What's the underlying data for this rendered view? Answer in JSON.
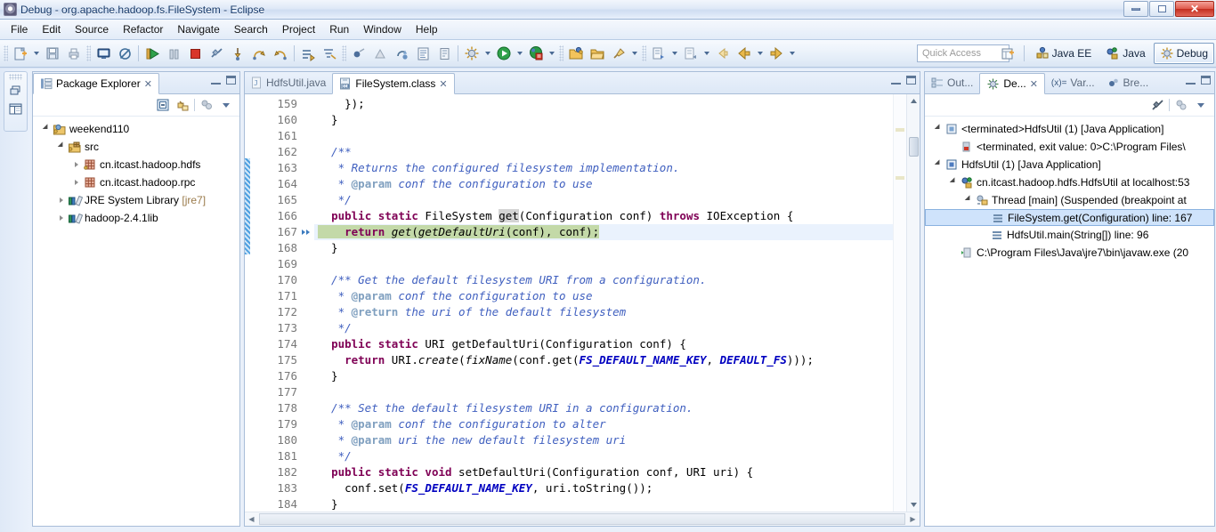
{
  "window": {
    "title": "Debug - org.apache.hadoop.fs.FileSystem - Eclipse",
    "app_icon": "eclipse-icon",
    "controls": {
      "minimize": "minimize-icon",
      "restore": "restore-icon",
      "close": "✕"
    }
  },
  "menubar": {
    "items": [
      {
        "label": "File"
      },
      {
        "label": "Edit"
      },
      {
        "label": "Source"
      },
      {
        "label": "Refactor"
      },
      {
        "label": "Navigate"
      },
      {
        "label": "Search"
      },
      {
        "label": "Project"
      },
      {
        "label": "Run"
      },
      {
        "label": "Window"
      },
      {
        "label": "Help"
      }
    ]
  },
  "toolbar": {
    "buttons": [
      {
        "name": "new-wizard-icon",
        "has_dropdown": true
      },
      {
        "name": "save-icon",
        "has_dropdown": false
      },
      {
        "name": "print-icon",
        "has_dropdown": false
      },
      {
        "name": "console-icon",
        "has_dropdown": false
      },
      {
        "name": "skip-breakpoints-icon",
        "has_dropdown": false
      },
      {
        "name": "resume-icon",
        "has_dropdown": false
      },
      {
        "name": "suspend-icon",
        "has_dropdown": false
      },
      {
        "name": "terminate-icon",
        "has_dropdown": false
      },
      {
        "name": "disconnect-icon",
        "has_dropdown": false
      },
      {
        "name": "step-into-icon",
        "has_dropdown": false
      },
      {
        "name": "step-over-icon",
        "has_dropdown": false
      },
      {
        "name": "step-return-icon",
        "has_dropdown": false
      },
      {
        "name": "drop-to-frame-icon",
        "has_dropdown": false
      },
      {
        "name": "use-step-filters-icon",
        "has_dropdown": false
      },
      {
        "name": "toggle-breakpoint-icon",
        "has_dropdown": false
      },
      {
        "name": "instruction-stepping-icon",
        "has_dropdown": false
      },
      {
        "name": "relaunch-icon",
        "has_dropdown": false
      },
      {
        "name": "open-type-icon",
        "has_dropdown": false
      },
      {
        "name": "open-task-icon",
        "has_dropdown": false
      },
      {
        "name": "debug-launch-icon",
        "has_dropdown": true
      },
      {
        "name": "run-launch-icon",
        "has_dropdown": true
      },
      {
        "name": "external-tools-icon",
        "has_dropdown": true
      },
      {
        "name": "new-folder-icon",
        "has_dropdown": false
      },
      {
        "name": "open-folder-icon",
        "has_dropdown": false
      },
      {
        "name": "pin-icon",
        "has_dropdown": true
      },
      {
        "name": "next-annotation-icon",
        "has_dropdown": true
      },
      {
        "name": "prev-annotation-icon",
        "has_dropdown": true
      },
      {
        "name": "back-icon",
        "has_dropdown": false
      },
      {
        "name": "last-edit-icon",
        "has_dropdown": true
      },
      {
        "name": "forward-icon",
        "has_dropdown": true
      }
    ],
    "quick_access_placeholder": "Quick Access",
    "open-perspective-icon": "open-perspective-icon",
    "perspectives": [
      {
        "label": "Java EE",
        "icon": "java-ee-perspective-icon",
        "active": false
      },
      {
        "label": "Java",
        "icon": "java-perspective-icon",
        "active": false
      },
      {
        "label": "Debug",
        "icon": "debug-perspective-icon",
        "active": true
      }
    ]
  },
  "fast_view_bar": {
    "icons": [
      "restore-view-icon",
      "package-explorer-fastview-icon"
    ]
  },
  "package_explorer": {
    "tab_label": "Package Explorer",
    "tab_icon": "package-explorer-icon",
    "close_glyph": "✕",
    "toolbar": [
      "collapse-all-icon",
      "link-with-editor-icon",
      "focus-on-active-task-icon",
      "view-menu-icon"
    ],
    "tree": [
      {
        "label": "weekend110",
        "icon": "java-project-icon",
        "indent": 0,
        "twisty": "open"
      },
      {
        "label": "src",
        "icon": "source-folder-icon",
        "indent": 1,
        "twisty": "open"
      },
      {
        "label": "cn.itcast.hadoop.hdfs",
        "icon": "package-icon",
        "indent": 2,
        "twisty": "closed"
      },
      {
        "label": "cn.itcast.hadoop.rpc",
        "icon": "package-icon",
        "indent": 2,
        "twisty": "closed"
      },
      {
        "label": "JRE System Library",
        "suffix": " [jre7]",
        "icon": "library-icon",
        "indent": 1,
        "twisty": "closed"
      },
      {
        "label": "hadoop-2.4.1lib",
        "icon": "library-icon",
        "indent": 1,
        "twisty": "closed"
      }
    ]
  },
  "editor": {
    "tabs": [
      {
        "label": "HdfsUtil.java",
        "icon": "java-file-icon",
        "active": false
      },
      {
        "label": "FileSystem.class",
        "icon": "class-file-icon",
        "active": true,
        "close_glyph": "✕"
      }
    ],
    "panel_controls": {
      "minimize": "minimize-icon",
      "maximize": "maximize-icon"
    },
    "current_line": 167,
    "instruction_pointer_line": 167,
    "instruction_pointer_icon": "instruction-pointer-arrow-icon",
    "first_line_number": 159,
    "lines": [
      {
        "n": 159,
        "fold": false,
        "tokens": [
          {
            "t": "    });",
            "c": ""
          }
        ]
      },
      {
        "n": 160,
        "fold": false,
        "tokens": [
          {
            "t": "  }",
            "c": ""
          }
        ]
      },
      {
        "n": 161,
        "fold": false,
        "tokens": [
          {
            "t": "",
            "c": ""
          }
        ]
      },
      {
        "n": 162,
        "fold": true,
        "tokens": [
          {
            "t": "  /**",
            "c": "cmt"
          }
        ]
      },
      {
        "n": 163,
        "fold": false,
        "tokens": [
          {
            "t": "   * Returns the configured filesystem implementation.",
            "c": "cmt"
          }
        ]
      },
      {
        "n": 164,
        "fold": false,
        "tokens": [
          {
            "t": "   * ",
            "c": "cmt"
          },
          {
            "t": "@param",
            "c": "jd-tag"
          },
          {
            "t": " conf the configuration to use",
            "c": "cmt"
          }
        ]
      },
      {
        "n": 165,
        "fold": false,
        "tokens": [
          {
            "t": "   */",
            "c": "cmt"
          }
        ]
      },
      {
        "n": 166,
        "fold": true,
        "tokens": [
          {
            "t": "  ",
            "c": ""
          },
          {
            "t": "public static",
            "c": "kw"
          },
          {
            "t": " FileSystem ",
            "c": ""
          },
          {
            "t": "get",
            "c": "occ"
          },
          {
            "t": "(Configuration conf) ",
            "c": ""
          },
          {
            "t": "throws",
            "c": "kw"
          },
          {
            "t": " IOException {",
            "c": ""
          }
        ]
      },
      {
        "n": 167,
        "fold": false,
        "highlight": "ip",
        "tokens": [
          {
            "t": "    ",
            "c": ""
          },
          {
            "t": "return",
            "c": "kw"
          },
          {
            "t": " ",
            "c": ""
          },
          {
            "t": "get",
            "c": "mth"
          },
          {
            "t": "(",
            "c": ""
          },
          {
            "t": "getDefaultUri",
            "c": "mth"
          },
          {
            "t": "(conf), conf);",
            "c": ""
          }
        ]
      },
      {
        "n": 168,
        "fold": false,
        "tokens": [
          {
            "t": "  }",
            "c": ""
          }
        ]
      },
      {
        "n": 169,
        "fold": false,
        "tokens": [
          {
            "t": "",
            "c": ""
          }
        ]
      },
      {
        "n": 170,
        "fold": true,
        "tokens": [
          {
            "t": "  /** Get the default filesystem URI from a configuration.",
            "c": "cmt"
          }
        ]
      },
      {
        "n": 171,
        "fold": false,
        "tokens": [
          {
            "t": "   * ",
            "c": "cmt"
          },
          {
            "t": "@param",
            "c": "jd-tag"
          },
          {
            "t": " conf the configuration to use",
            "c": "cmt"
          }
        ]
      },
      {
        "n": 172,
        "fold": false,
        "tokens": [
          {
            "t": "   * ",
            "c": "cmt"
          },
          {
            "t": "@return",
            "c": "jd-tag"
          },
          {
            "t": " the uri of the default filesystem",
            "c": "cmt"
          }
        ]
      },
      {
        "n": 173,
        "fold": false,
        "tokens": [
          {
            "t": "   */",
            "c": "cmt"
          }
        ]
      },
      {
        "n": 174,
        "fold": true,
        "tokens": [
          {
            "t": "  ",
            "c": ""
          },
          {
            "t": "public static",
            "c": "kw"
          },
          {
            "t": " URI getDefaultUri(Configuration conf) {",
            "c": ""
          }
        ]
      },
      {
        "n": 175,
        "fold": false,
        "tokens": [
          {
            "t": "    ",
            "c": ""
          },
          {
            "t": "return",
            "c": "kw"
          },
          {
            "t": " URI.",
            "c": ""
          },
          {
            "t": "create",
            "c": "mth"
          },
          {
            "t": "(",
            "c": ""
          },
          {
            "t": "fixName",
            "c": "mth"
          },
          {
            "t": "(conf.get(",
            "c": ""
          },
          {
            "t": "FS_DEFAULT_NAME_KEY",
            "c": "stc"
          },
          {
            "t": ", ",
            "c": ""
          },
          {
            "t": "DEFAULT_FS",
            "c": "stc"
          },
          {
            "t": ")));",
            "c": ""
          }
        ]
      },
      {
        "n": 176,
        "fold": false,
        "tokens": [
          {
            "t": "  }",
            "c": ""
          }
        ]
      },
      {
        "n": 177,
        "fold": false,
        "tokens": [
          {
            "t": "",
            "c": ""
          }
        ]
      },
      {
        "n": 178,
        "fold": true,
        "tokens": [
          {
            "t": "  /** Set the default filesystem URI in a configuration.",
            "c": "cmt"
          }
        ]
      },
      {
        "n": 179,
        "fold": false,
        "tokens": [
          {
            "t": "   * ",
            "c": "cmt"
          },
          {
            "t": "@param",
            "c": "jd-tag"
          },
          {
            "t": " conf the configuration to alter",
            "c": "cmt"
          }
        ]
      },
      {
        "n": 180,
        "fold": false,
        "tokens": [
          {
            "t": "   * ",
            "c": "cmt"
          },
          {
            "t": "@param",
            "c": "jd-tag"
          },
          {
            "t": " uri the new default filesystem uri",
            "c": "cmt"
          }
        ]
      },
      {
        "n": 181,
        "fold": false,
        "tokens": [
          {
            "t": "   */",
            "c": "cmt"
          }
        ]
      },
      {
        "n": 182,
        "fold": true,
        "tokens": [
          {
            "t": "  ",
            "c": ""
          },
          {
            "t": "public static void",
            "c": "kw"
          },
          {
            "t": " setDefaultUri(Configuration conf, URI uri) {",
            "c": ""
          }
        ]
      },
      {
        "n": 183,
        "fold": false,
        "tokens": [
          {
            "t": "    conf.set(",
            "c": ""
          },
          {
            "t": "FS_DEFAULT_NAME_KEY",
            "c": "stc"
          },
          {
            "t": ", uri.toString());",
            "c": ""
          }
        ]
      },
      {
        "n": 184,
        "fold": false,
        "tokens": [
          {
            "t": "  }",
            "c": ""
          }
        ]
      }
    ]
  },
  "debug_view": {
    "tabs": [
      {
        "label": "Out...",
        "icon": "outline-icon",
        "active": false
      },
      {
        "label": "De...",
        "icon": "debug-icon",
        "active": true,
        "close_glyph": "✕"
      },
      {
        "label": "Var...",
        "icon": "variables-icon",
        "prefix": "(x)=",
        "active": false
      },
      {
        "label": "Bre...",
        "icon": "breakpoints-icon",
        "active": false
      }
    ],
    "panel_controls": {
      "minimize": "minimize-icon",
      "maximize": "maximize-icon"
    },
    "toolbar": [
      "disconnect-icon",
      "view-separator",
      "relaunch-icon",
      "view-menu-icon"
    ],
    "tree": [
      {
        "label": "<terminated>HdfsUtil (1) [Java Application]",
        "icon": "terminated-launch-icon",
        "indent": 0,
        "twisty": "open"
      },
      {
        "label": "<terminated, exit value: 0>C:\\Program Files\\",
        "icon": "terminated-process-icon",
        "indent": 1,
        "twisty": "none"
      },
      {
        "label": "HdfsUtil (1) [Java Application]",
        "icon": "launch-icon",
        "indent": 0,
        "twisty": "open"
      },
      {
        "label": "cn.itcast.hadoop.hdfs.HdfsUtil at localhost:53",
        "icon": "debug-target-icon",
        "indent": 1,
        "twisty": "open"
      },
      {
        "label": "Thread [main] (Suspended (breakpoint at",
        "icon": "thread-suspended-icon",
        "indent": 2,
        "twisty": "open"
      },
      {
        "label": "FileSystem.get(Configuration) line: 167",
        "icon": "stack-frame-icon",
        "indent": 3,
        "twisty": "none",
        "selected": true
      },
      {
        "label": "HdfsUtil.main(String[]) line: 96",
        "icon": "stack-frame-icon",
        "indent": 3,
        "twisty": "none"
      },
      {
        "label": "C:\\Program Files\\Java\\jre7\\bin\\javaw.exe (20",
        "icon": "system-process-icon",
        "indent": 1,
        "twisty": "none"
      }
    ]
  },
  "colors": {
    "keyword": "#7f0055",
    "comment": "#3f5fbf",
    "static_field": "#0000c0",
    "current_instruction_highlight": "#c3d9a8",
    "current_line_highlight": "#eaf2fd",
    "selection": "#cfe3fb",
    "chrome": "#dbe6f4"
  }
}
